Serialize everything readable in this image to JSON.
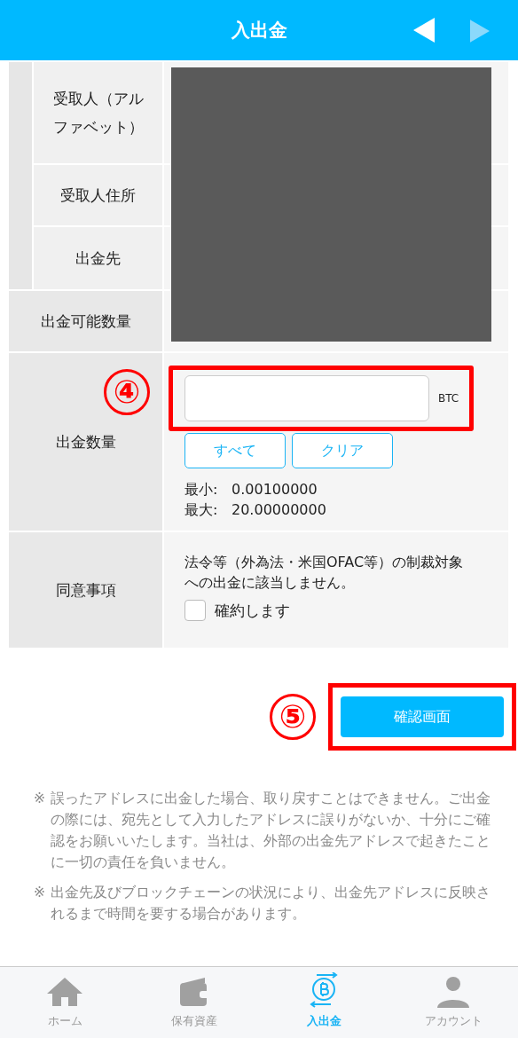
{
  "header": {
    "title": "入出金"
  },
  "recipient_rows": [
    {
      "label": "受取人（アルファベット）"
    },
    {
      "label": "受取人住所"
    },
    {
      "label": "出金先"
    }
  ],
  "available": {
    "label": "出金可能数量"
  },
  "amount": {
    "label": "出金数量",
    "annotation": "④",
    "unit": "BTC",
    "buttons": [
      "すべて",
      "クリア"
    ],
    "limits": [
      {
        "label": "最小:",
        "value": "0.00100000"
      },
      {
        "label": "最大:",
        "value": "20.00000000"
      }
    ]
  },
  "consent": {
    "label": "同意事項",
    "text": "法令等（外為法・米国OFAC等）の制裁対象への出金に該当しません。",
    "checkbox": {
      "label": "確約します",
      "checked": false
    }
  },
  "confirm": {
    "annotation": "⑤",
    "label": "確認画面"
  },
  "notes": [
    {
      "mark": "※",
      "text": "誤ったアドレスに出金した場合、取り戻すことはできません。ご出金の際には、宛先として入力したアドレスに誤りがないか、十分にご確認をお願いいたします。当社は、外部の出金先アドレスで起きたことに一切の責任を負いません。"
    },
    {
      "mark": "※",
      "text": "出金先及びブロックチェーンの状況により、出金先アドレスに反映されるまで時間を要する場合があります。"
    }
  ],
  "nav": [
    {
      "kind": "home",
      "label": "ホーム",
      "selected": false
    },
    {
      "kind": "wallet",
      "label": "保有資産",
      "selected": false
    },
    {
      "kind": "transfer",
      "label": "入出金",
      "selected": true
    },
    {
      "kind": "account",
      "label": "アカウント",
      "selected": false
    }
  ]
}
